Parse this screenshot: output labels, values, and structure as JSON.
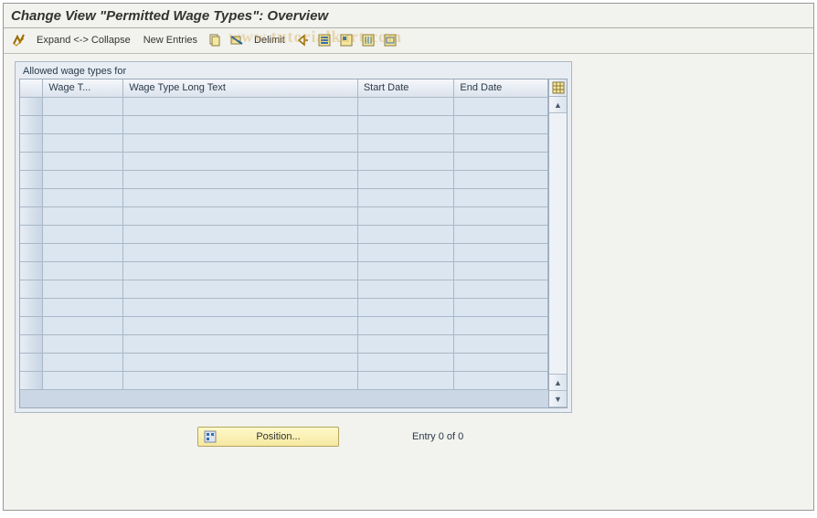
{
  "title": "Change View \"Permitted Wage Types\": Overview",
  "toolbar": {
    "expand_collapse": "Expand <-> Collapse",
    "new_entries": "New Entries",
    "delimit": "Delimit"
  },
  "panel": {
    "title": "Allowed wage types for",
    "columns": {
      "wage_type": "Wage T...",
      "long_text": "Wage Type Long Text",
      "start_date": "Start Date",
      "end_date": "End Date"
    }
  },
  "footer": {
    "position_label": "Position...",
    "entry_status": "Entry 0 of 0"
  },
  "watermark": "www.tutorialkart.com"
}
